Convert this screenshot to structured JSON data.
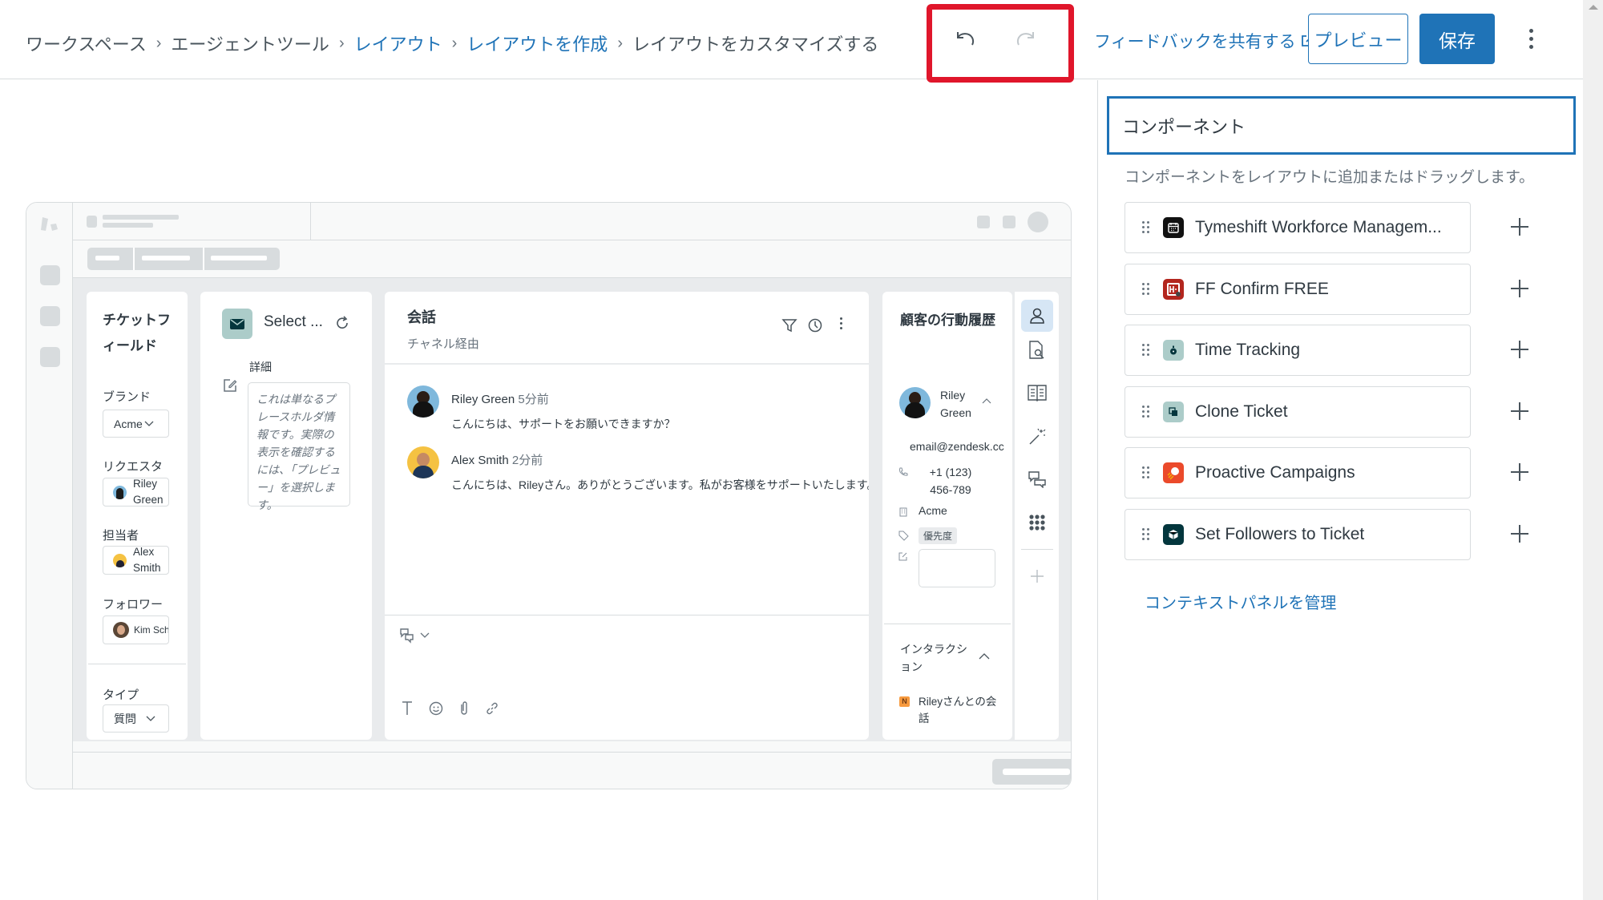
{
  "header": {
    "breadcrumbs": [
      {
        "label": "ワークスペース",
        "link": false
      },
      {
        "label": "エージェントツール",
        "link": false
      },
      {
        "label": "レイアウト",
        "link": true
      },
      {
        "label": "レイアウトを作成",
        "link": true
      },
      {
        "label": "レイアウトをカスタマイズする",
        "link": false
      }
    ],
    "separator": "›",
    "undo_icon": "undo-icon",
    "redo_icon": "redo-icon",
    "feedback_label": "フィードバックを共有する",
    "preview_label": "プレビュー",
    "save_label": "保存",
    "more_icon": "kebab-menu-icon",
    "highlight_color": "#e0162b"
  },
  "colors": {
    "accent": "#1f73b7",
    "text": "#2f3941",
    "border": "#d8dcde"
  },
  "components_panel": {
    "title": "コンポーネント",
    "description": "コンポーネントをレイアウトに追加またはドラッグします。",
    "items": [
      {
        "label": "Tymeshift Workforce Managem...",
        "icon": "calendar-app-icon",
        "icon_bg": "#111111"
      },
      {
        "label": "FF Confirm FREE",
        "icon": "ff-confirm-app-icon",
        "icon_bg": "#b3261e"
      },
      {
        "label": "Time Tracking",
        "icon": "stopwatch-app-icon",
        "icon_bg": "#acccc9"
      },
      {
        "label": "Clone Ticket",
        "icon": "clone-app-icon",
        "icon_bg": "#acccc9"
      },
      {
        "label": "Proactive Campaigns",
        "icon": "campaign-app-icon",
        "icon_bg": "#eb4a2b"
      },
      {
        "label": "Set Followers to Ticket",
        "icon": "cube-app-icon",
        "icon_bg": "#03363d"
      }
    ],
    "manage_link": "コンテキストパネルを管理"
  },
  "mockup": {
    "ticket_fields": {
      "title": "チケットフィールド",
      "brand_label": "ブランド",
      "brand_value": "Acme",
      "requester_label": "リクエスタ",
      "requester_value": "Riley Green",
      "assignee_label": "担当者",
      "assignee_value": "Alex Smith",
      "followers_label": "フォロワー",
      "followers_value": "Kim Sch",
      "type_label": "タイプ",
      "type_value": "質問"
    },
    "app_panel": {
      "title": "Select ...",
      "details_label": "詳細",
      "placeholder_text": "これは単なるプレースホルダ情報です。実際の表示を確認するには、「プレビュー」を選択します。"
    },
    "conversation": {
      "title": "会話",
      "subtitle": "チャネル経由",
      "messages": [
        {
          "author": "Riley Green",
          "time": "5分前",
          "text": "こんにちは、サポートをお願いできますか？",
          "avatar_bg": "#7fb8dc"
        },
        {
          "author": "Alex Smith",
          "time": "2分前",
          "text": "こんにちは、Rileyさん。ありがとうございます。私がお客様をサポートいたします。",
          "avatar_bg": "#f5c242"
        }
      ]
    },
    "customer": {
      "title": "顧客の行動履歴",
      "name": "Riley Green",
      "email": "email@zendesk.cc",
      "phone": "+1 (123) 456-789",
      "org": "Acme",
      "tag": "優先度",
      "interactions_title": "インタラクション",
      "interaction_item": "Rileyさんとの会話",
      "interaction_badge": "N"
    }
  }
}
